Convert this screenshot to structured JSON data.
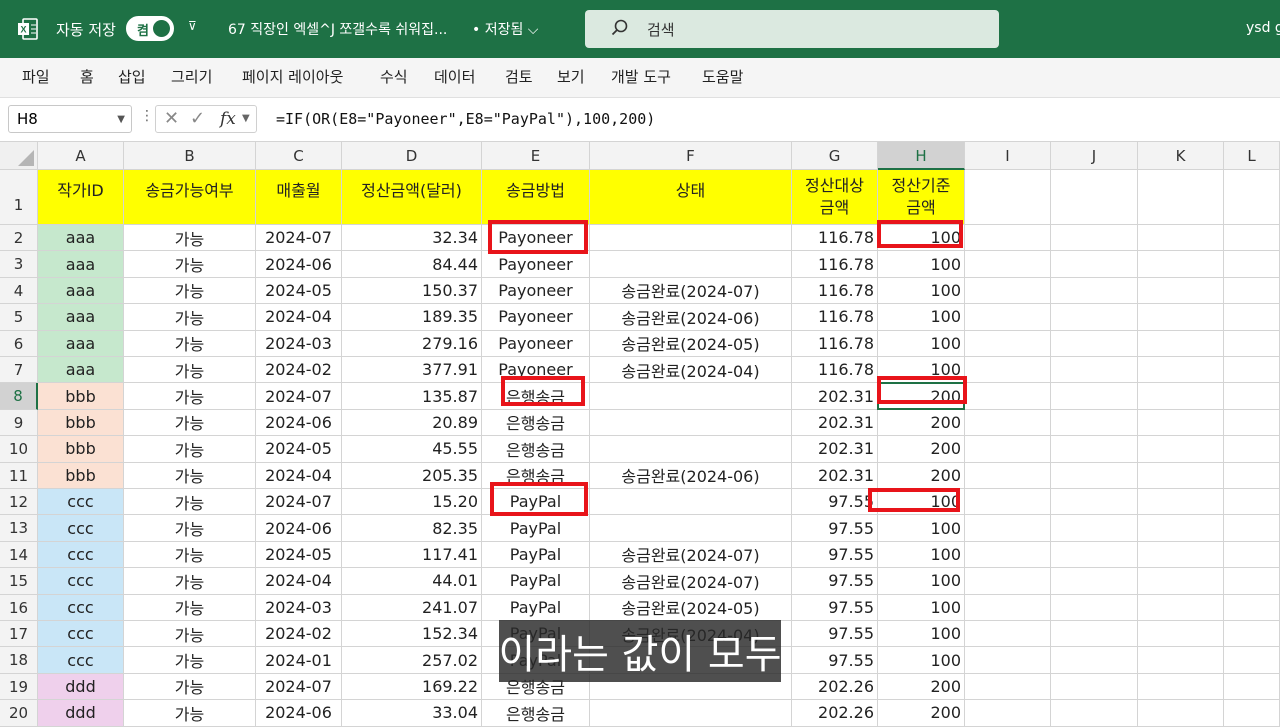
{
  "titlebar": {
    "autosave_label": "자동 저장",
    "autosave_state": "켬",
    "doc_title": "67 직장인 엑셀^J 쪼갤수록 쉬워집...",
    "save_state": "• 저장됨 ⌵",
    "search_placeholder": "검색",
    "user": "ysd g"
  },
  "ribbon": [
    "파일",
    "홈",
    "삽입",
    "그리기",
    "페이지 레이아웃",
    "수식",
    "데이터",
    "검토",
    "보기",
    "개발 도구",
    "도움말"
  ],
  "formula_bar": {
    "name_box": "H8",
    "formula": "=IF(OR(E8=\"Payoneer\",E8=\"PayPal\"),100,200)"
  },
  "columns": [
    "A",
    "B",
    "C",
    "D",
    "E",
    "F",
    "G",
    "H",
    "I",
    "J",
    "K",
    "L"
  ],
  "selected_column": "H",
  "selected_row": "8",
  "headers": {
    "A": "작가ID",
    "B": "송금가능여부",
    "C": "매출월",
    "D": "정산금액(달러)",
    "E": "송금방법",
    "F": "상태",
    "G": "정산대상\n금액",
    "H": "정산기준\n금액"
  },
  "rows": [
    {
      "n": "2",
      "a": "aaa",
      "b": "가능",
      "c": "2024-07",
      "d": "32.34",
      "e": "Payoneer",
      "f": "",
      "g": "116.78",
      "h": "100"
    },
    {
      "n": "3",
      "a": "aaa",
      "b": "가능",
      "c": "2024-06",
      "d": "84.44",
      "e": "Payoneer",
      "f": "",
      "g": "116.78",
      "h": "100"
    },
    {
      "n": "4",
      "a": "aaa",
      "b": "가능",
      "c": "2024-05",
      "d": "150.37",
      "e": "Payoneer",
      "f": "송금완료(2024-07)",
      "g": "116.78",
      "h": "100"
    },
    {
      "n": "5",
      "a": "aaa",
      "b": "가능",
      "c": "2024-04",
      "d": "189.35",
      "e": "Payoneer",
      "f": "송금완료(2024-06)",
      "g": "116.78",
      "h": "100"
    },
    {
      "n": "6",
      "a": "aaa",
      "b": "가능",
      "c": "2024-03",
      "d": "279.16",
      "e": "Payoneer",
      "f": "송금완료(2024-05)",
      "g": "116.78",
      "h": "100"
    },
    {
      "n": "7",
      "a": "aaa",
      "b": "가능",
      "c": "2024-02",
      "d": "377.91",
      "e": "Payoneer",
      "f": "송금완료(2024-04)",
      "g": "116.78",
      "h": "100"
    },
    {
      "n": "8",
      "a": "bbb",
      "b": "가능",
      "c": "2024-07",
      "d": "135.87",
      "e": "은행송금",
      "f": "",
      "g": "202.31",
      "h": "200"
    },
    {
      "n": "9",
      "a": "bbb",
      "b": "가능",
      "c": "2024-06",
      "d": "20.89",
      "e": "은행송금",
      "f": "",
      "g": "202.31",
      "h": "200"
    },
    {
      "n": "10",
      "a": "bbb",
      "b": "가능",
      "c": "2024-05",
      "d": "45.55",
      "e": "은행송금",
      "f": "",
      "g": "202.31",
      "h": "200"
    },
    {
      "n": "11",
      "a": "bbb",
      "b": "가능",
      "c": "2024-04",
      "d": "205.35",
      "e": "은행송금",
      "f": "송금완료(2024-06)",
      "g": "202.31",
      "h": "200"
    },
    {
      "n": "12",
      "a": "ccc",
      "b": "가능",
      "c": "2024-07",
      "d": "15.20",
      "e": "PayPal",
      "f": "",
      "g": "97.55",
      "h": "100"
    },
    {
      "n": "13",
      "a": "ccc",
      "b": "가능",
      "c": "2024-06",
      "d": "82.35",
      "e": "PayPal",
      "f": "",
      "g": "97.55",
      "h": "100"
    },
    {
      "n": "14",
      "a": "ccc",
      "b": "가능",
      "c": "2024-05",
      "d": "117.41",
      "e": "PayPal",
      "f": "송금완료(2024-07)",
      "g": "97.55",
      "h": "100"
    },
    {
      "n": "15",
      "a": "ccc",
      "b": "가능",
      "c": "2024-04",
      "d": "44.01",
      "e": "PayPal",
      "f": "송금완료(2024-07)",
      "g": "97.55",
      "h": "100"
    },
    {
      "n": "16",
      "a": "ccc",
      "b": "가능",
      "c": "2024-03",
      "d": "241.07",
      "e": "PayPal",
      "f": "송금완료(2024-05)",
      "g": "97.55",
      "h": "100"
    },
    {
      "n": "17",
      "a": "ccc",
      "b": "가능",
      "c": "2024-02",
      "d": "152.34",
      "e": "PayPal",
      "f": "송금완료(2024-04)",
      "g": "97.55",
      "h": "100"
    },
    {
      "n": "18",
      "a": "ccc",
      "b": "가능",
      "c": "2024-01",
      "d": "257.02",
      "e": "PayPal",
      "f": "",
      "g": "97.55",
      "h": "100"
    },
    {
      "n": "19",
      "a": "ddd",
      "b": "가능",
      "c": "2024-07",
      "d": "169.22",
      "e": "은행송금",
      "f": "",
      "g": "202.26",
      "h": "200"
    },
    {
      "n": "20",
      "a": "ddd",
      "b": "가능",
      "c": "2024-06",
      "d": "33.04",
      "e": "은행송금",
      "f": "",
      "g": "202.26",
      "h": "200"
    }
  ],
  "id_colors": {
    "aaa": "#c6e8cd",
    "bbb": "#fbe1d3",
    "ccc": "#c9e6f7",
    "ddd": "#efd0ec"
  },
  "header_color": "#ffff00",
  "caption": "이라는 값이 모두"
}
